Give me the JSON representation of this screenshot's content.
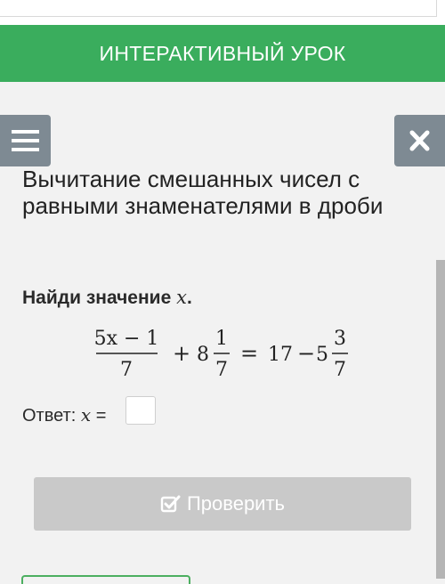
{
  "banner": {
    "title": "ИНТЕРАКТИВНЫЙ УРОК",
    "color": "#3aad5d"
  },
  "toolbar": {
    "menu_icon": "hamburger-icon",
    "close_icon": "close-icon"
  },
  "lesson": {
    "title": "Вычитание смешанных чисел с равными знаменателями в дроби"
  },
  "task": {
    "prompt": "Найди значение",
    "variable": "x",
    "equation": {
      "left_numerator": "5x − 1",
      "left_denominator": "7",
      "plus": "+",
      "whole1": "8",
      "frac1_numerator": "1",
      "frac1_denominator": "7",
      "equals": "=",
      "right_whole": "17",
      "minus": "−",
      "whole2": "5",
      "frac2_numerator": "3",
      "frac2_denominator": "7"
    }
  },
  "answer": {
    "label": "Ответ:",
    "variable": "x",
    "equals": "=",
    "value": ""
  },
  "check_button": {
    "label": "Проверить",
    "icon": "checkbox-check-icon"
  }
}
